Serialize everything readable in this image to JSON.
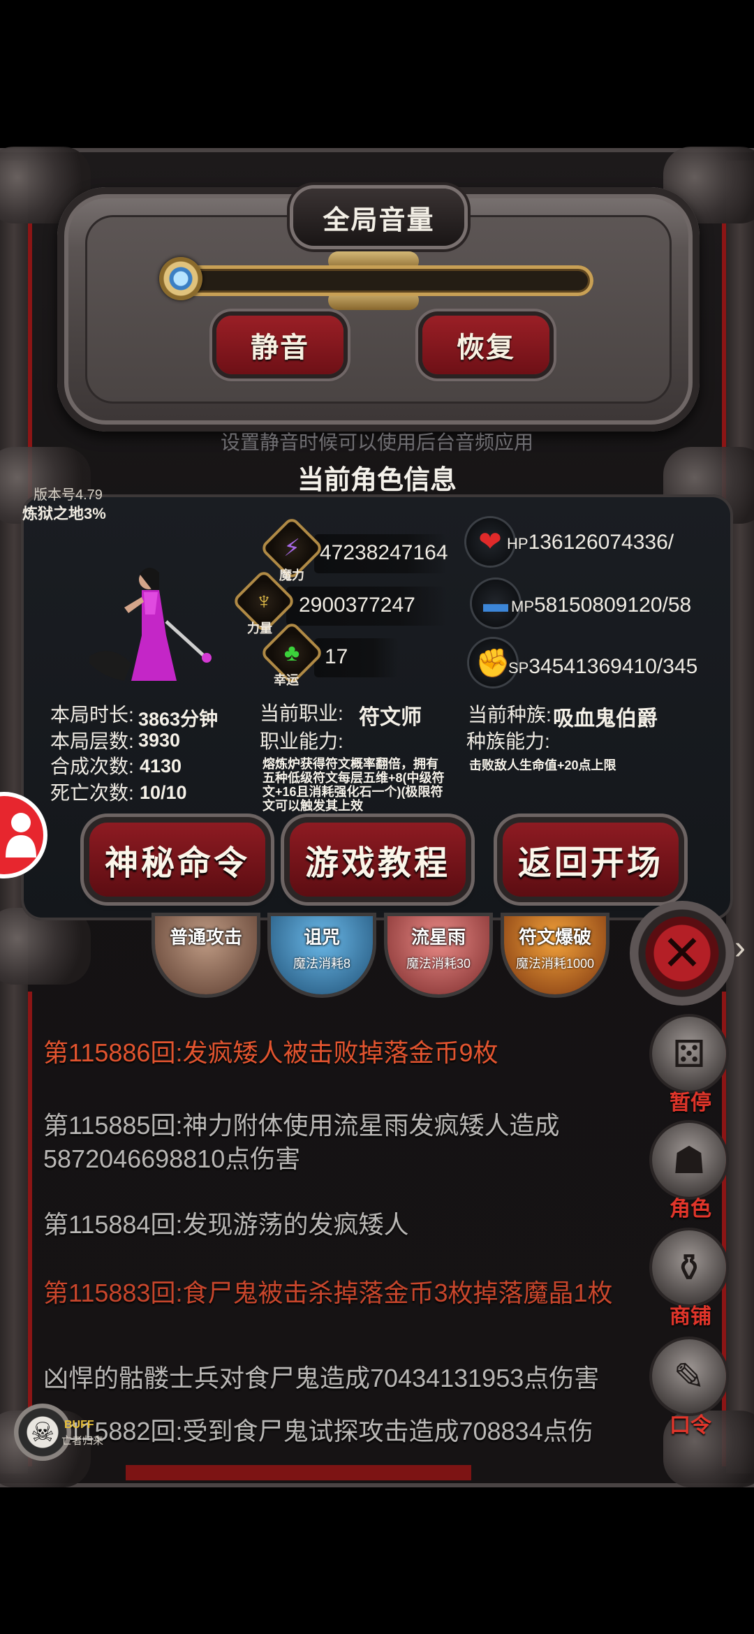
{
  "volume": {
    "title": "全局音量",
    "level": 0.0,
    "mute_label": "静音",
    "restore_label": "恢复",
    "hint": "设置静音时候可以使用后台音频应用"
  },
  "info": {
    "title": "当前角色信息",
    "version": "版本号4.79",
    "realm": "炼狱之地3%"
  },
  "stats": {
    "magic": {
      "caption": "魔力",
      "value": "47238247164"
    },
    "strength": {
      "caption": "力量",
      "value": "2900377247"
    },
    "luck": {
      "caption": "幸运",
      "value": "17"
    }
  },
  "resources": {
    "hp": {
      "tag": "HP",
      "value": "136126074336/"
    },
    "mp": {
      "tag": "MP",
      "value": "58150809120/58"
    },
    "sp": {
      "tag": "SP",
      "value": "34541369410/345"
    }
  },
  "session": {
    "duration_label": "本局时长:",
    "duration_value": "3863分钟",
    "floors_label": "本局层数:",
    "floors_value": "3930",
    "synth_label": "合成次数:",
    "synth_value": "4130",
    "deaths_label": "死亡次数:",
    "deaths_value": "10/10"
  },
  "job": {
    "label": "当前职业:",
    "value": "符文师",
    "ability_label": "职业能力:",
    "ability_desc": "熔炼炉获得符文概率翻倍，拥有五种低级符文每层五维+8(中级符文+16且消耗强化石一个)(极限符文可以触发其上效"
  },
  "race": {
    "label": "当前种族:",
    "value": "吸血鬼伯爵",
    "ability_label": "种族能力:",
    "ability_desc": "击败敌人生命值+20点上限"
  },
  "buttons": {
    "secret": "神秘命令",
    "tutorial": "游戏教程",
    "return": "返回开场"
  },
  "skills": [
    {
      "name": "普通攻击",
      "cost": ""
    },
    {
      "name": "诅咒",
      "cost": "魔法消耗8"
    },
    {
      "name": "流星雨",
      "cost": "魔法消耗30"
    },
    {
      "name": "符文爆破",
      "cost": "魔法消耗1000"
    }
  ],
  "log": [
    {
      "text": "第115886回:发疯矮人被击败掉落金币9枚",
      "color": "#e2542f"
    },
    {
      "text": "第115885回:神力附体使用流星雨发疯矮人造成5872046698810点伤害",
      "color": "#b9b7b5"
    },
    {
      "text": "第115884回:发现游荡的发疯矮人",
      "color": "#b9b7b5"
    },
    {
      "text": "第115883回:食尸鬼被击杀掉落金币3枚掉落魔晶1枚",
      "color": "#c8462c"
    },
    {
      "text": "凶悍的骷髅士兵对食尸鬼造成70434131953点伤害",
      "color": "#b9b7b5"
    },
    {
      "text": "第115882回:受到食尸鬼试探攻击造成708834点伤",
      "color": "#b9b7b5"
    }
  ],
  "menu": {
    "pause": "暂停",
    "character": "角色",
    "shop": "商铺",
    "password": "口令"
  },
  "buff": {
    "tag": "BUFF",
    "sub": "亡者归来"
  }
}
